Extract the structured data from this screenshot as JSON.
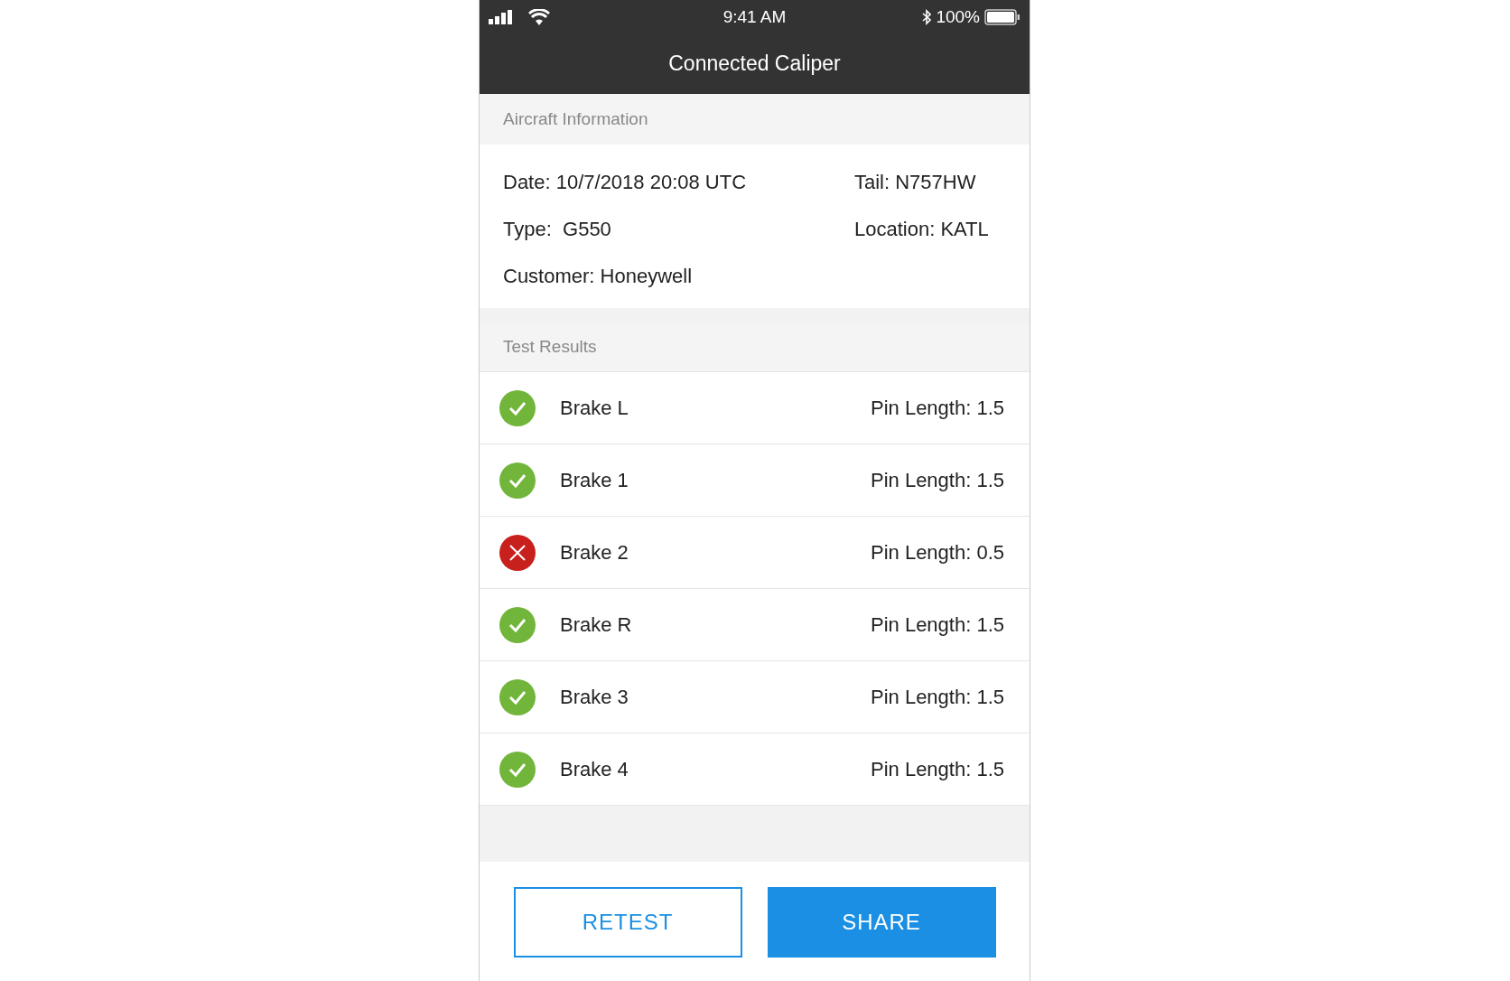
{
  "status_bar": {
    "time": "9:41 AM",
    "battery": "100%"
  },
  "header": {
    "title": "Connected Caliper"
  },
  "aircraft_information": {
    "heading": "Aircraft Information",
    "date": "Date: 10/7/2018 20:08 UTC",
    "tail": "Tail: N757HW",
    "type": "Type:  G550",
    "location": "Location: KATL",
    "customer": "Customer: Honeywell"
  },
  "test_results": {
    "heading": "Test Results",
    "rows": [
      {
        "name": "Brake L",
        "passed": true,
        "reading": "Pin Length: 1.5"
      },
      {
        "name": "Brake 1",
        "passed": true,
        "reading": "Pin Length: 1.5"
      },
      {
        "name": "Brake 2",
        "passed": false,
        "reading": "Pin Length: 0.5"
      },
      {
        "name": "Brake R",
        "passed": true,
        "reading": "Pin Length: 1.5"
      },
      {
        "name": "Brake 3",
        "passed": true,
        "reading": "Pin Length: 1.5"
      },
      {
        "name": "Brake 4",
        "passed": true,
        "reading": "Pin Length: 1.5"
      }
    ]
  },
  "buttons": [
    {
      "label": "RETEST",
      "kind": "outline"
    },
    {
      "label": "SHARE",
      "kind": "filled"
    }
  ]
}
